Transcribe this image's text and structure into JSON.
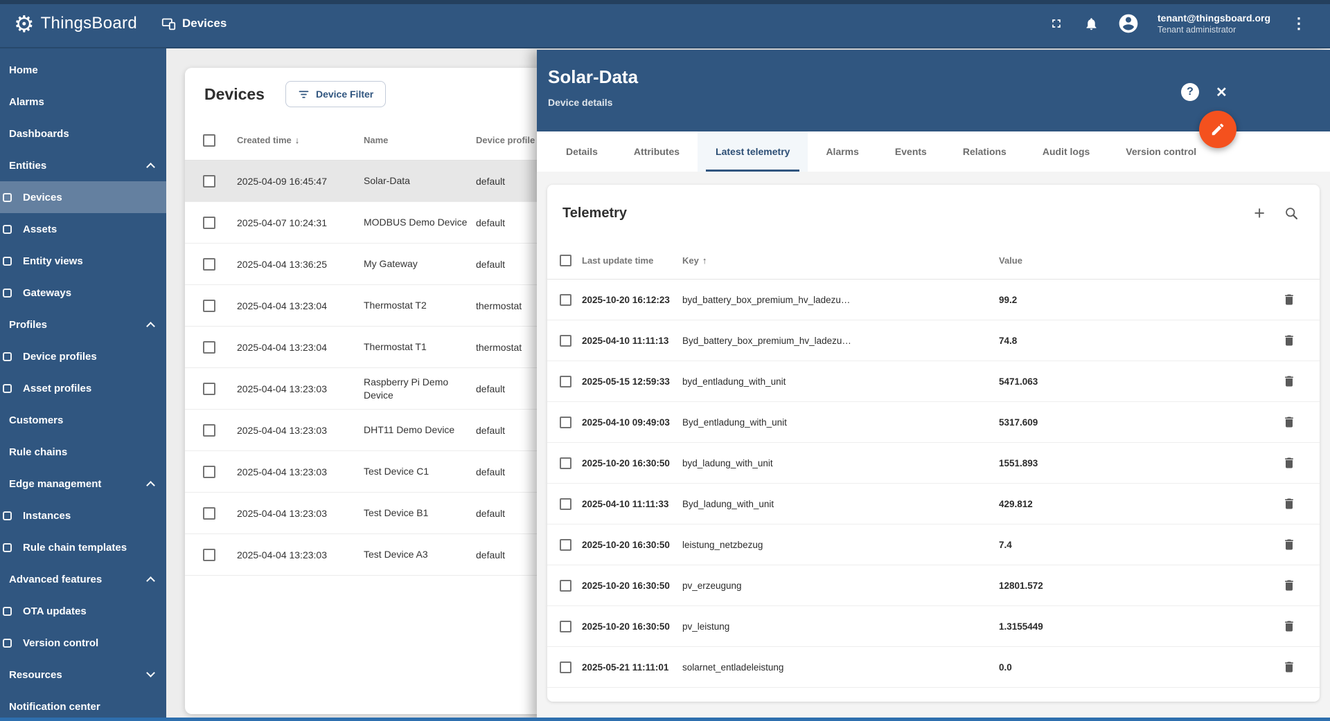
{
  "topbar": {
    "brand": "ThingsBoard",
    "page_title": "Devices",
    "user": {
      "email": "tenant@thingsboard.org",
      "role": "Tenant administrator"
    }
  },
  "sidebar": {
    "items": [
      {
        "label": "Home",
        "type": "top"
      },
      {
        "label": "Alarms",
        "type": "top"
      },
      {
        "label": "Dashboards",
        "type": "top"
      },
      {
        "label": "Entities",
        "type": "group",
        "chevron": "up"
      },
      {
        "label": "Devices",
        "type": "sub",
        "icon": "devices-icon",
        "selected": true
      },
      {
        "label": "Assets",
        "type": "sub",
        "icon": "assets-icon"
      },
      {
        "label": "Entity views",
        "type": "sub",
        "icon": "entity-views-icon"
      },
      {
        "label": "Gateways",
        "type": "sub",
        "icon": "gateways-icon"
      },
      {
        "label": "Profiles",
        "type": "group",
        "chevron": "up"
      },
      {
        "label": "Device profiles",
        "type": "sub",
        "icon": "device-profiles-icon"
      },
      {
        "label": "Asset profiles",
        "type": "sub",
        "icon": "asset-profiles-icon"
      },
      {
        "label": "Customers",
        "type": "top"
      },
      {
        "label": "Rule chains",
        "type": "top"
      },
      {
        "label": "Edge management",
        "type": "group",
        "chevron": "up"
      },
      {
        "label": "Instances",
        "type": "sub",
        "icon": "instances-icon"
      },
      {
        "label": "Rule chain templates",
        "type": "sub",
        "icon": "rule-chain-templates-icon"
      },
      {
        "label": "Advanced features",
        "type": "group",
        "chevron": "up"
      },
      {
        "label": "OTA updates",
        "type": "sub",
        "icon": "ota-updates-icon"
      },
      {
        "label": "Version control",
        "type": "sub",
        "icon": "version-control-icon"
      },
      {
        "label": "Resources",
        "type": "group",
        "chevron": "down"
      },
      {
        "label": "Notification center",
        "type": "top"
      }
    ]
  },
  "devices_table": {
    "title": "Devices",
    "filter_button_label": "Device Filter",
    "columns": {
      "created_time": "Created time",
      "name": "Name",
      "device_profile": "Device profile"
    },
    "sort": {
      "column": "Created time",
      "direction": "desc",
      "arrow": "↓"
    },
    "rows": [
      {
        "created_time": "2025-04-09 16:45:47",
        "name": "Solar-Data",
        "profile": "default",
        "selected": true
      },
      {
        "created_time": "2025-04-07 10:24:31",
        "name": "MODBUS Demo Device",
        "profile": "default"
      },
      {
        "created_time": "2025-04-04 13:36:25",
        "name": "My Gateway",
        "profile": "default"
      },
      {
        "created_time": "2025-04-04 13:23:04",
        "name": "Thermostat T2",
        "profile": "thermostat"
      },
      {
        "created_time": "2025-04-04 13:23:04",
        "name": "Thermostat T1",
        "profile": "thermostat"
      },
      {
        "created_time": "2025-04-04 13:23:03",
        "name": "Raspberry Pi Demo Device",
        "profile": "default"
      },
      {
        "created_time": "2025-04-04 13:23:03",
        "name": "DHT11 Demo Device",
        "profile": "default"
      },
      {
        "created_time": "2025-04-04 13:23:03",
        "name": "Test Device C1",
        "profile": "default"
      },
      {
        "created_time": "2025-04-04 13:23:03",
        "name": "Test Device B1",
        "profile": "default"
      },
      {
        "created_time": "2025-04-04 13:23:03",
        "name": "Test Device A3",
        "profile": "default"
      }
    ]
  },
  "details_panel": {
    "title": "Solar-Data",
    "subtitle": "Device details",
    "tabs": [
      "Details",
      "Attributes",
      "Latest telemetry",
      "Alarms",
      "Events",
      "Relations",
      "Audit logs",
      "Version control"
    ],
    "active_tab": "Latest telemetry",
    "telemetry": {
      "title": "Telemetry",
      "columns": {
        "last_update_time": "Last update time",
        "key": "Key",
        "value": "Value"
      },
      "sort": {
        "column": "Key",
        "direction": "asc",
        "arrow": "↑"
      },
      "rows": [
        {
          "time": "2025-10-20 16:12:23",
          "key": "byd_battery_box_premium_hv_ladezu…",
          "value": "99.2"
        },
        {
          "time": "2025-04-10 11:11:13",
          "key": "Byd_battery_box_premium_hv_ladezu…",
          "value": "74.8"
        },
        {
          "time": "2025-05-15 12:59:33",
          "key": "byd_entladung_with_unit",
          "value": "5471.063"
        },
        {
          "time": "2025-04-10 09:49:03",
          "key": "Byd_entladung_with_unit",
          "value": "5317.609"
        },
        {
          "time": "2025-10-20 16:30:50",
          "key": "byd_ladung_with_unit",
          "value": "1551.893"
        },
        {
          "time": "2025-04-10 11:11:33",
          "key": "Byd_ladung_with_unit",
          "value": "429.812"
        },
        {
          "time": "2025-10-20 16:30:50",
          "key": "leistung_netzbezug",
          "value": "7.4"
        },
        {
          "time": "2025-10-20 16:30:50",
          "key": "pv_erzeugung",
          "value": "12801.572"
        },
        {
          "time": "2025-10-20 16:30:50",
          "key": "pv_leistung",
          "value": "1.3155449"
        },
        {
          "time": "2025-05-21 11:11:01",
          "key": "solarnet_entladeleistung",
          "value": "0.0"
        }
      ]
    }
  },
  "colors": {
    "primary": "#305680",
    "fab": "#f4511e",
    "selected_row": "#e7e7e7",
    "active_tab_text": "#2c4e74"
  },
  "glyphs": {
    "gear": "⚙",
    "more_menu": "⋮",
    "close": "✕",
    "help": "?",
    "add": "+"
  }
}
